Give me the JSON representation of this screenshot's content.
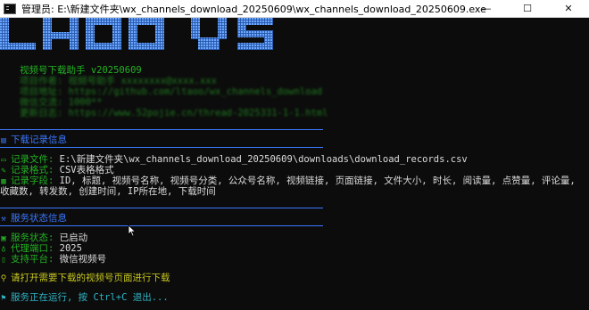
{
  "window": {
    "title": "管理员: E:\\新建文件夹\\wx_channels_download_20250609\\wx_channels_download_20250609.exe",
    "minimize_glyph": "—",
    "maximize_glyph": "☐",
    "close_glyph": "✕"
  },
  "banner": {
    "app_name": "视频号下载助手 v20250609",
    "blurred_lines": [
      "项目作者: 视频号助手 xxxxxxxx@xxxx.xxx",
      "项目地址: https://github.com/ltaoo/wx_channels_download",
      "微信交流: 1000**",
      "更新日志: https://www.52pojie.cn/thread-2025331-1-1.html"
    ]
  },
  "records": {
    "heading": "下载记录信息",
    "file_label": "记录文件:",
    "file_value": "E:\\新建文件夹\\wx_channels_download_20250609\\downloads\\download_records.csv",
    "format_label": "记录格式:",
    "format_value": "CSV表格格式",
    "fields_label": "记录字段:",
    "fields_value_1": "ID, 标题, 视频号名称, 视频号分类, 公众号名称, 视频链接, 页面链接, 文件大小, 时长, 阅读量, 点赞量, 评论量,",
    "fields_value_2": "收藏数, 转发数, 创建时间, IP所在地, 下载时间"
  },
  "service": {
    "heading": "服务状态信息",
    "status_label": "服务状态:",
    "status_value": "已启动",
    "port_label": "代理端口:",
    "port_value": "2025",
    "platform_label": "支持平台:",
    "platform_value": "微信视频号"
  },
  "messages": {
    "open_page": "请打开需要下载的视频号页面进行下载",
    "running": "服务正在运行, 按 Ctrl+C 退出..."
  },
  "colors": {
    "background": "#0c0c0c",
    "green": "#23b223",
    "blue": "#3b78ff",
    "yellow": "#c8c81e",
    "cyan": "#2fb3c4"
  }
}
